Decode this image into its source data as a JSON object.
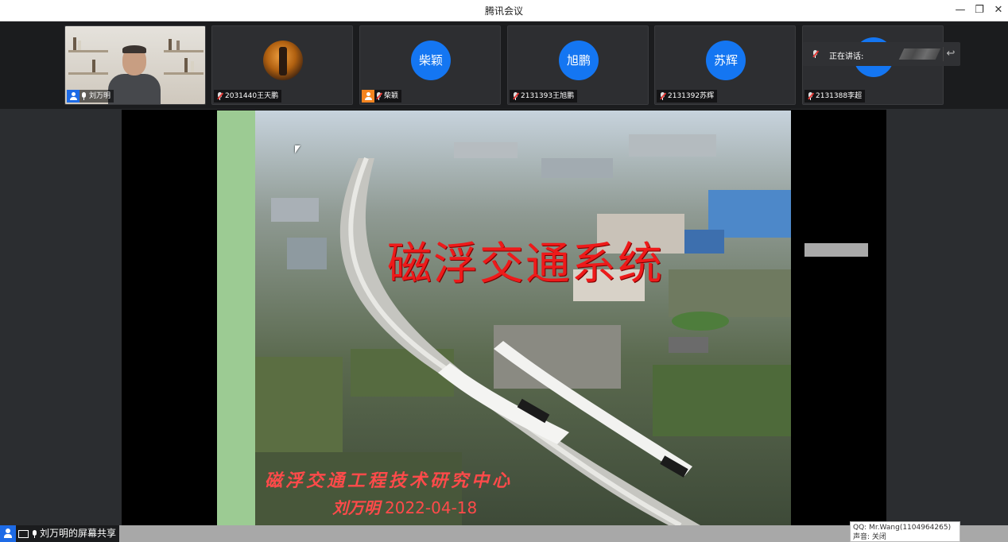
{
  "window": {
    "title": "腾讯会议"
  },
  "participants": [
    {
      "name": "刘万明"
    },
    {
      "name": "2031440王天鹏"
    },
    {
      "name": "柴颖",
      "avatar_text": "柴颖"
    },
    {
      "name": "2131393王旭鹏",
      "avatar_text": "旭鹏"
    },
    {
      "name": "2131392苏辉",
      "avatar_text": "苏辉"
    },
    {
      "name": "2131388李超"
    }
  ],
  "speaking": {
    "label": "正在讲话:"
  },
  "slide": {
    "title": "磁浮交通系统",
    "subtitle": "磁浮交通工程技术研究中心",
    "author": "刘万明",
    "date": "2022-04-18"
  },
  "share_bar": {
    "label": "刘万明的屏幕共享"
  },
  "overlay": {
    "qq": "QQ: Mr.Wang(1104964265)",
    "sound": "声音: 关闭"
  },
  "colors": {
    "avatar_blue": "#1476f2",
    "title_red": "#ee1a1a",
    "slide_green": "#9ccb93"
  }
}
